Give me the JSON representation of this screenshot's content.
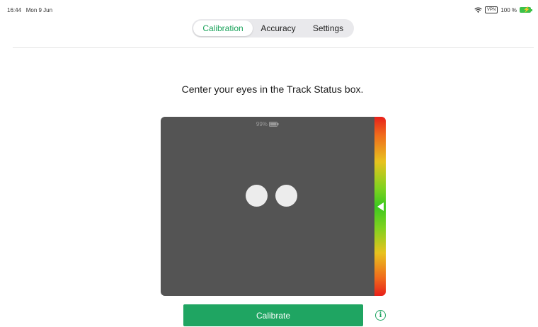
{
  "status_bar": {
    "time": "16:44",
    "date": "Mon 9 Jun",
    "vpn": "VPN",
    "battery_percent": "100 %",
    "icons": [
      "wifi-icon",
      "battery-charging-icon"
    ],
    "battery_color": "#3cc14a"
  },
  "tabs": [
    {
      "label": "Calibration",
      "active": true
    },
    {
      "label": "Accuracy",
      "active": false
    },
    {
      "label": "Settings",
      "active": false
    }
  ],
  "instruction": "Center your eyes in the Track Status box.",
  "track_status": {
    "device_battery": "99%",
    "device_battery_icon": "battery-icon",
    "distance_level": 0.5
  },
  "calibrate_button": {
    "label": "Calibrate"
  },
  "info_button": {
    "icon": "info-icon",
    "glyph": "i"
  },
  "colors": {
    "accent": "#1fa562",
    "track_box": "#545454",
    "active_tab_text": "#1aa35a"
  }
}
